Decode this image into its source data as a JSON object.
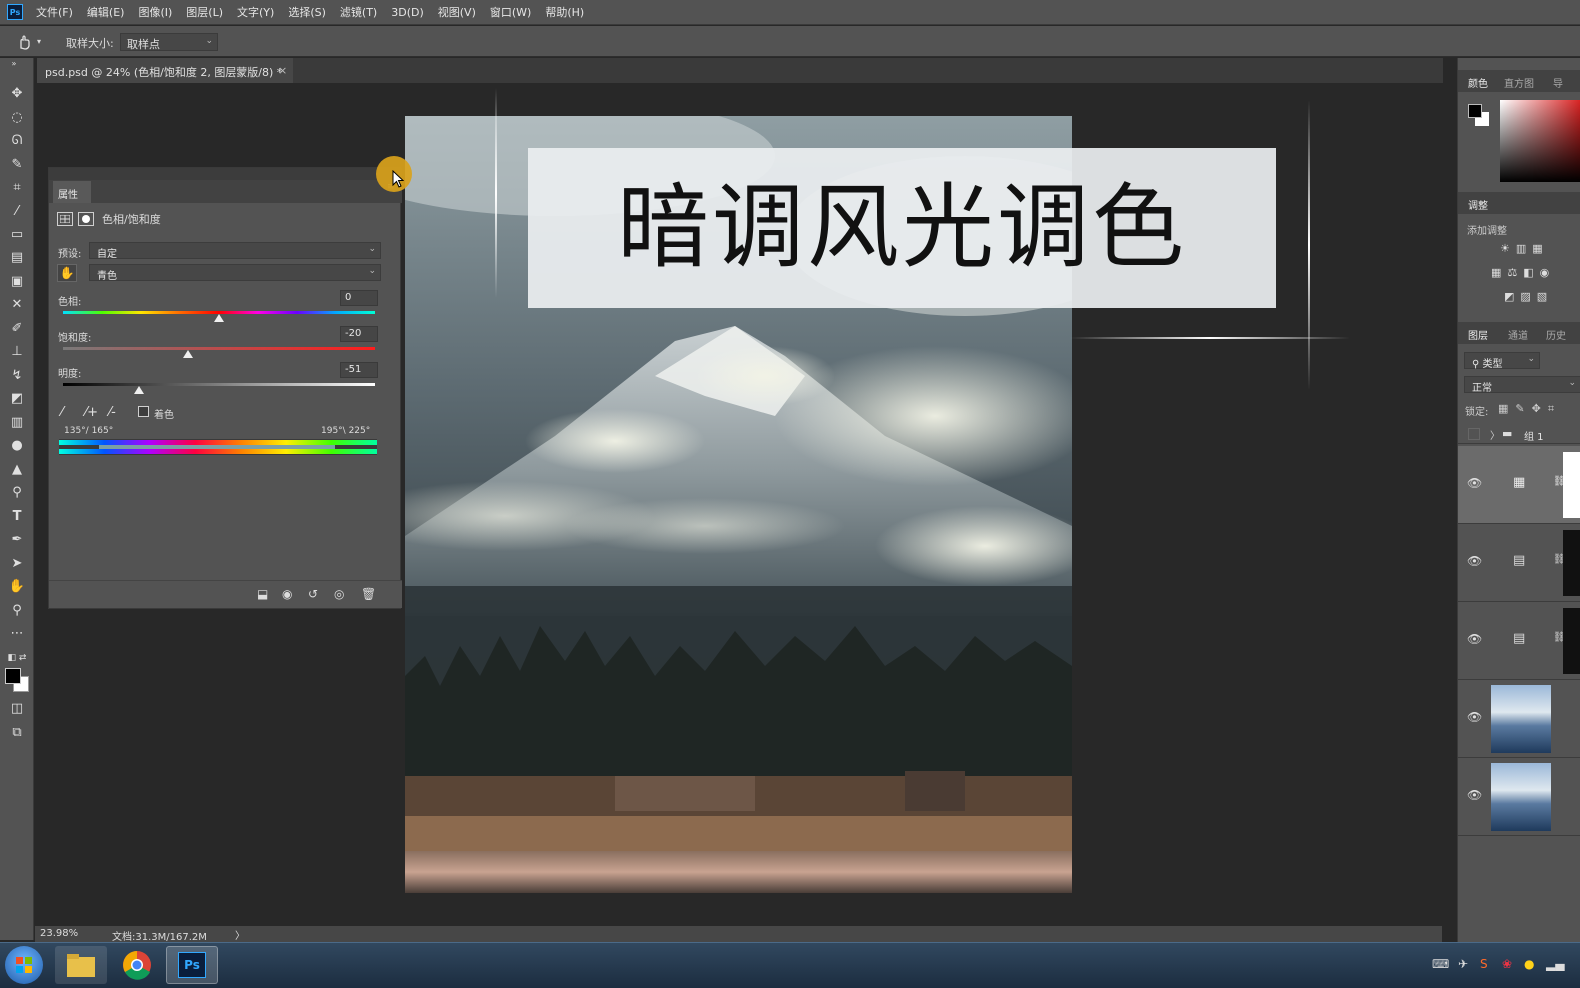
{
  "app": {
    "logo": "Ps"
  },
  "menu": [
    "文件(F)",
    "编辑(E)",
    "图像(I)",
    "图层(L)",
    "文字(Y)",
    "选择(S)",
    "滤镜(T)",
    "3D(D)",
    "视图(V)",
    "窗口(W)",
    "帮助(H)"
  ],
  "options": {
    "sample_label": "取样大小:",
    "sample_value": "取样点"
  },
  "document": {
    "tab_title": "psd.psd @ 24% (色相/饱和度 2, 图层蒙版/8) *",
    "close_glyph": "×"
  },
  "canvas": {
    "title_overlay": "暗调风光调色"
  },
  "properties": {
    "tab": "属性",
    "adjustment_name": "色相/饱和度",
    "preset_label": "预设:",
    "preset_value": "自定",
    "channel_value": "青色",
    "hue_label": "色相:",
    "hue_value": "0",
    "saturation_label": "饱和度:",
    "saturation_value": "-20",
    "lightness_label": "明度:",
    "lightness_value": "-51",
    "colorize_label": "着色",
    "range_left": "135°/ 165°",
    "range_right": "195°\\ 225°",
    "hue_fraction": 0.5,
    "saturation_fraction": 0.4,
    "lightness_fraction": 0.245
  },
  "status": {
    "zoom": "23.98%",
    "doc": "文档:31.3M/167.2M",
    "arrow": "〉"
  },
  "right_panels": {
    "color_tabs": [
      "颜色",
      "直方图",
      "导"
    ],
    "adjust_tab": "调整",
    "adjust_add": "添加调整",
    "layer_tabs": [
      "图层",
      "通道",
      "历史"
    ],
    "filter_label": "类型",
    "blend_mode": "正常",
    "lock_label": "锁定:",
    "group_name": "组 1"
  },
  "colors": {
    "accent": "#31a8ff",
    "panel": "#535353",
    "dark": "#282828",
    "cursor_halo": "#d9a21b"
  }
}
